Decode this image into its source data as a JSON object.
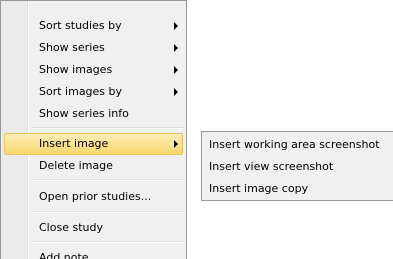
{
  "context_menu": {
    "items": [
      {
        "label": "Sort studies by",
        "has_submenu": true
      },
      {
        "label": "Show series",
        "has_submenu": true
      },
      {
        "label": "Show images",
        "has_submenu": true
      },
      {
        "label": "Sort images by",
        "has_submenu": true
      },
      {
        "label": "Show series info",
        "has_submenu": false
      },
      {
        "label": "Insert image",
        "has_submenu": true,
        "highlighted": true
      },
      {
        "label": "Delete image",
        "has_submenu": false
      },
      {
        "label": "Open prior studies...",
        "has_submenu": false
      },
      {
        "label": "Close study",
        "has_submenu": false
      },
      {
        "label": "Add note",
        "has_submenu": false
      }
    ]
  },
  "submenu": {
    "items": [
      {
        "label": "Insert working area screenshot"
      },
      {
        "label": "Insert view screenshot"
      },
      {
        "label": "Insert image copy"
      }
    ]
  },
  "colors": {
    "menu_background": "#f0f0f0",
    "highlight": "#fbe08c",
    "border": "#979797"
  }
}
